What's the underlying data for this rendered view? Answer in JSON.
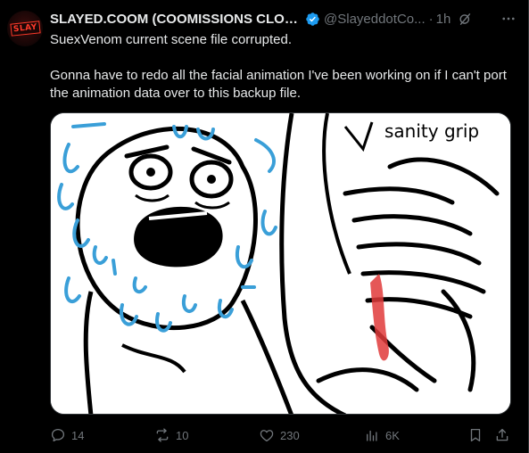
{
  "post": {
    "avatar_text": "SLAY",
    "display_name": "SLAYED.COOM (COOMISSIONS CLOS...",
    "handle": "@SlayeddotCo...",
    "separator": "·",
    "time": "1h",
    "body_line1": "SuexVenom current scene file corrupted.",
    "body_line2": "Gonna have to redo all the facial animation I've been working on if I can't port the animation data over to this backup file.",
    "media": {
      "caption": "sanity grip"
    },
    "actions": {
      "replies": "14",
      "reposts": "10",
      "likes": "230",
      "views": "6K"
    }
  },
  "colors": {
    "background": "#000000",
    "text": "#e7e9ea",
    "muted": "#71767b",
    "verified": "#1d9bf0",
    "border": "#2f3336"
  },
  "icons": [
    "more-icon",
    "verified-badge-icon",
    "grok-icon",
    "reply-icon",
    "repost-icon",
    "like-icon",
    "views-icon",
    "bookmark-icon",
    "share-icon"
  ]
}
